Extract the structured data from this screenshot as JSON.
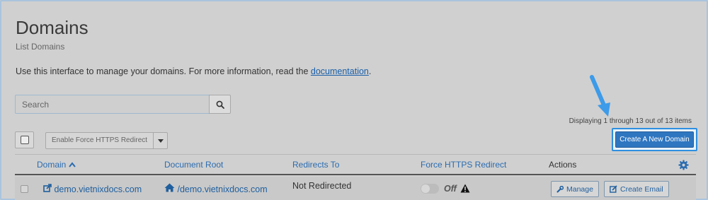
{
  "header": {
    "title": "Domains",
    "subtitle": "List Domains"
  },
  "intro": {
    "text": "Use this interface to manage your domains. For more information, read the ",
    "link": "documentation",
    "suffix": "."
  },
  "search": {
    "placeholder": "Search",
    "value": ""
  },
  "pagination": {
    "displaying": "Displaying 1 through 13 out of 13 items"
  },
  "toolbar": {
    "bulk_action_label": "Enable Force HTTPS Redirect",
    "create_label": "Create A New Domain"
  },
  "table": {
    "columns": {
      "domain": "Domain",
      "document_root": "Document Root",
      "redirects_to": "Redirects To",
      "force_https": "Force HTTPS Redirect",
      "actions": "Actions"
    },
    "rows": [
      {
        "domain": "demo.vietnixdocs.com",
        "document_root": "/demo.vietnixdocs.com",
        "redirects_to": "Not Redirected",
        "force_https": "Off",
        "manage_label": "Manage",
        "create_email_label": "Create Email"
      }
    ]
  },
  "colors": {
    "accent": "#2f76c0",
    "link": "#1f5f9e",
    "callout_arrow": "#3d9be9"
  },
  "icons": [
    "search-icon",
    "chevron-down-icon",
    "sort-up-icon",
    "external-link-icon",
    "home-icon",
    "warning-icon",
    "wrench-icon",
    "edit-icon",
    "gear-icon"
  ]
}
